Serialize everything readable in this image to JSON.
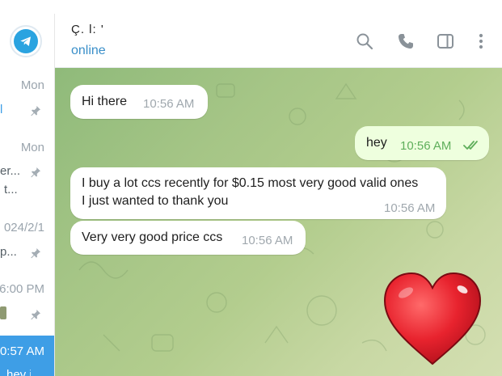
{
  "sidebar": {
    "items": [
      {
        "time": "Mon",
        "preview": "l",
        "pinned": true,
        "active": false
      },
      {
        "time": "Mon",
        "preview": "er...",
        "preview2": "t...",
        "pinned": true,
        "active": false
      },
      {
        "time": "024/2/1",
        "preview": "p...",
        "pinned": true,
        "active": false
      },
      {
        "time": "6:00 PM",
        "preview": "",
        "pinned": true,
        "active": false
      },
      {
        "time": "0:57 AM",
        "preview": "hey i",
        "pinned": false,
        "active": true
      }
    ]
  },
  "header": {
    "name": "Ç.  l:  '",
    "status": "online"
  },
  "messages": [
    {
      "direction": "in",
      "text": "Hi there",
      "time": "10:56 AM"
    },
    {
      "direction": "out",
      "text": "hey",
      "time": "10:56 AM",
      "read": true
    },
    {
      "direction": "in",
      "lines": [
        "I buy a lot ccs recently for $0.15 most very good valid ones",
        "I just wanted to thank you"
      ],
      "time": "10:56 AM"
    },
    {
      "direction": "in",
      "text": "Very very good price ccs",
      "time": "10:56 AM"
    },
    {
      "direction": "in",
      "sticker": "red-heart",
      "emoji": "❤️"
    }
  ],
  "colors": {
    "accent": "#3e9ee6",
    "online": "#3a8fc9",
    "outgoing_bubble": "#eeffde",
    "check": "#5fae5b",
    "heart": "#e8232e"
  }
}
